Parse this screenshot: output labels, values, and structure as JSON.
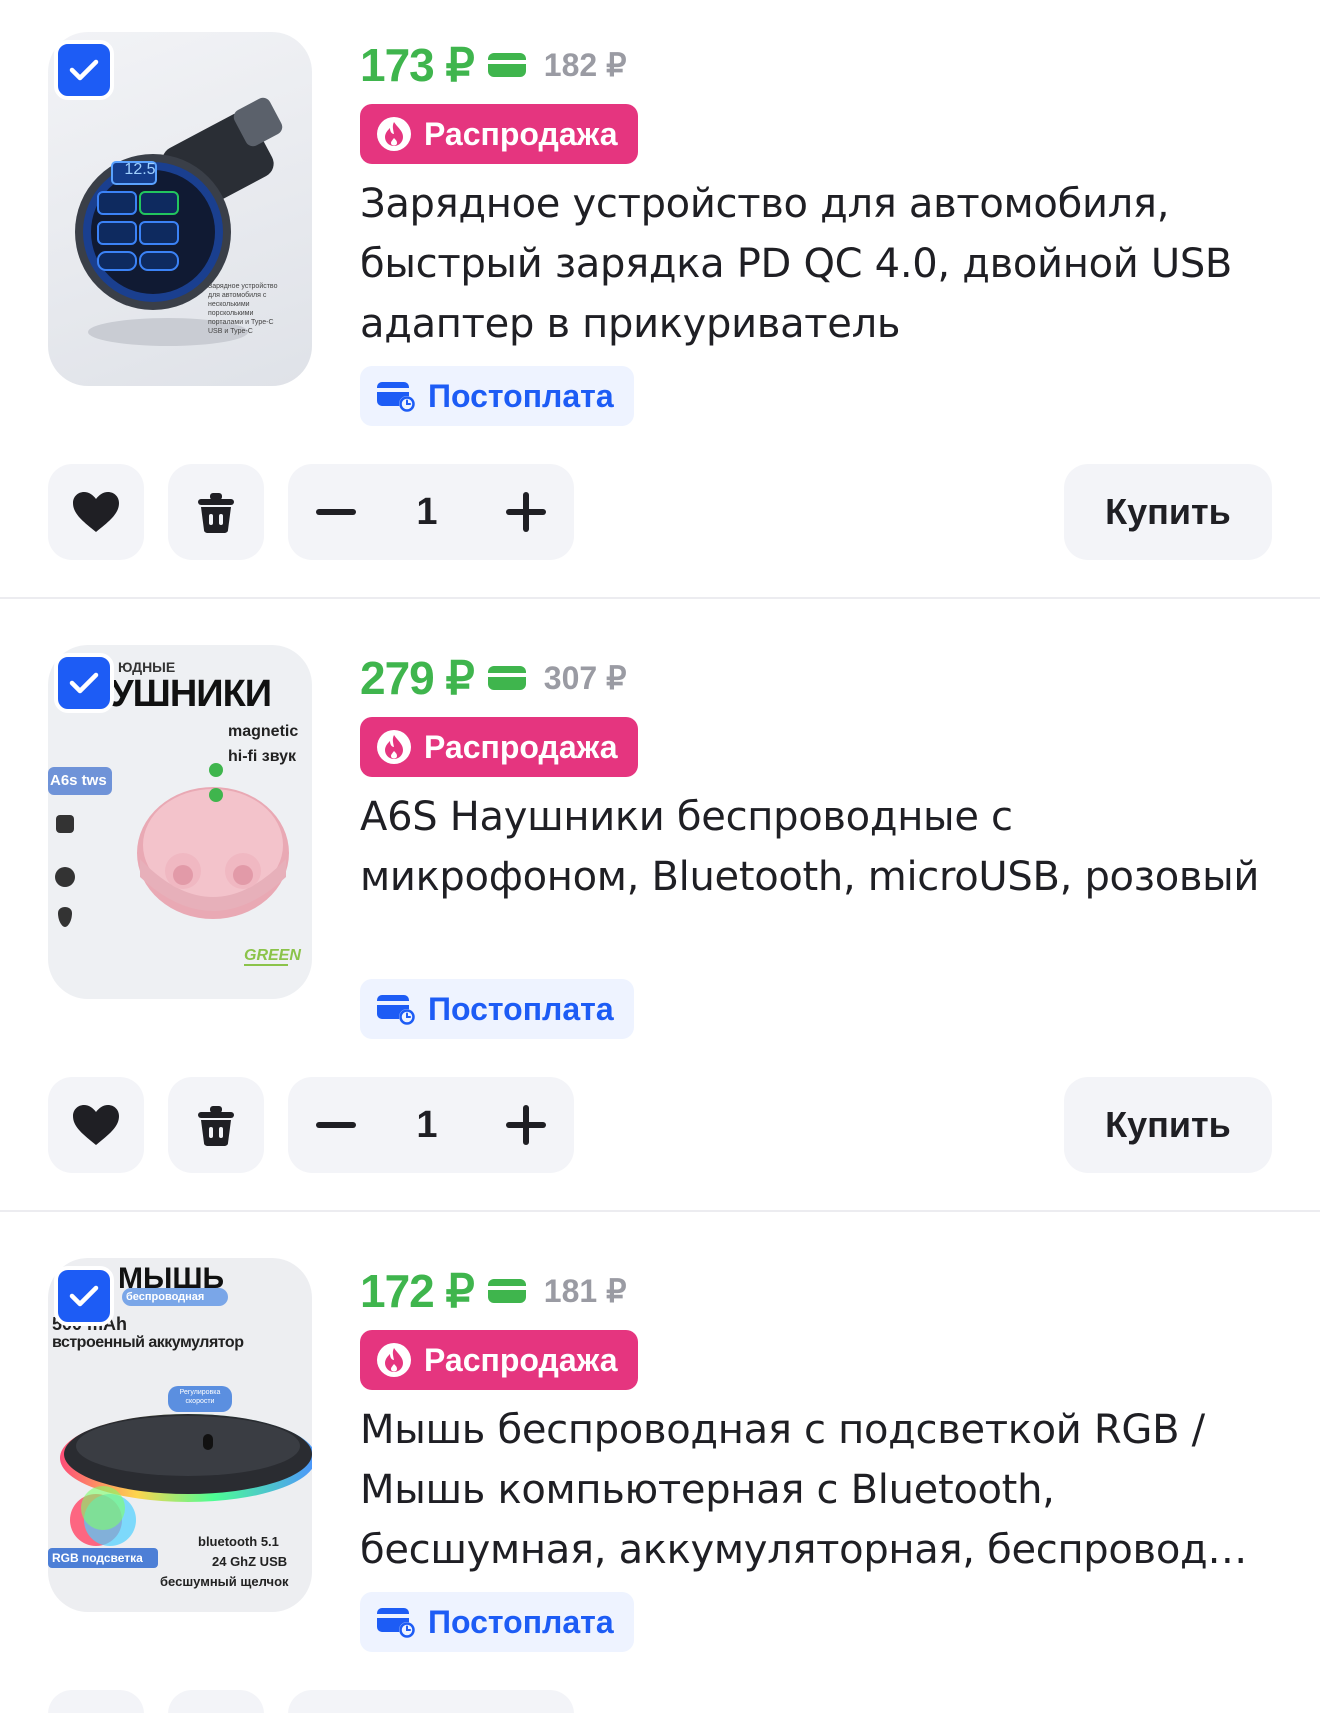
{
  "cart": {
    "items": [
      {
        "price": "173 ₽",
        "old_price": "182 ₽",
        "badge": "Распродажа",
        "title": "Зарядное устройство для автомобиля, быстрый зарядка PD QC 4.0, двойной USB адаптер в прикуриватель",
        "payment_tag": "Постоплата",
        "quantity": "1",
        "buy_label": "Купить",
        "selected": true,
        "image": {
          "display": "12.5",
          "caption": "Зарядное устройство для автомобиля с несколькими порсколькими порталами и Type-C USB и Type-C"
        }
      },
      {
        "price": "279 ₽",
        "old_price": "307 ₽",
        "badge": "Распродажа",
        "title": "A6S Наушники беспроводные с микрофоном, Bluetooth, microUSB, розовый",
        "payment_tag": "Постоплата",
        "quantity": "1",
        "buy_label": "Купить",
        "selected": true,
        "image": {
          "top_small": "ЮДНЫЕ",
          "top_big": "УШНИКИ",
          "feature_1": "magnetic",
          "feature_2": "hi-fi звук",
          "model_tag": "A6s tws",
          "brand": "GREEN"
        }
      },
      {
        "price": "172 ₽",
        "old_price": "181 ₽",
        "badge": "Распродажа",
        "title": "Мышь беспроводная с подсветкой RGB / Мышь компьютерная с Bluetooth, бесшумная, аккумуляторная, беспровод…",
        "payment_tag": "Постоплата",
        "selected": true,
        "image": {
          "title": "МЫШЬ",
          "subtitle": "беспроводная",
          "battery": "500 mAh",
          "battery_note": "встроенный аккумулятор",
          "speed_note": "Регулировка скорости",
          "rgb_tag": "RGB подсветка",
          "spec_1": "bluetooth 5.1",
          "spec_2": "24 GhZ USB",
          "spec_3": "бесшумный щелчок"
        }
      }
    ]
  },
  "colors": {
    "price_green": "#3fb54d",
    "sale_pink": "#e5357f",
    "accent_blue": "#1d5cf5",
    "button_bg": "#f3f4f8"
  },
  "icons": [
    "checkbox-checked-icon",
    "wallet-card-icon",
    "fire-icon",
    "postpay-card-clock-icon",
    "heart-icon",
    "trash-icon",
    "minus-icon",
    "plus-icon"
  ]
}
